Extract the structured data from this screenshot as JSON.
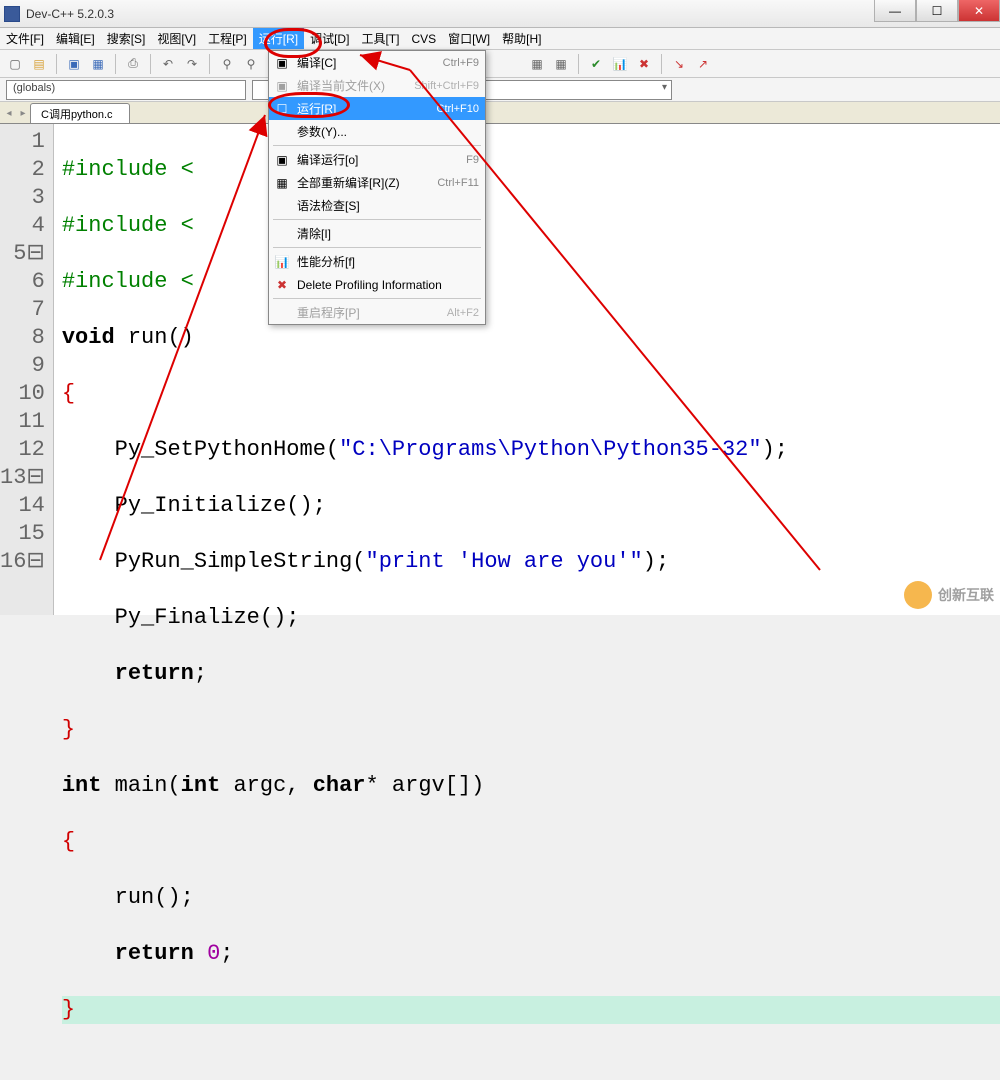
{
  "window": {
    "title": "Dev-C++ 5.2.0.3"
  },
  "menubar": {
    "items": [
      {
        "label": "文件[F]"
      },
      {
        "label": "编辑[E]"
      },
      {
        "label": "搜索[S]"
      },
      {
        "label": "视图[V]"
      },
      {
        "label": "工程[P]"
      },
      {
        "label": "运行[R]",
        "active": true
      },
      {
        "label": "调试[D]"
      },
      {
        "label": "工具[T]"
      },
      {
        "label": "CVS"
      },
      {
        "label": "窗口[W]"
      },
      {
        "label": "帮助[H]"
      }
    ]
  },
  "globals": {
    "label": "(globals)"
  },
  "tabs": {
    "file": "C调用python.c"
  },
  "dropdown": {
    "items": [
      {
        "icon": "cube",
        "label": "编译[C]",
        "shortcut": "Ctrl+F9"
      },
      {
        "icon": "cube",
        "label": "编译当前文件(X)",
        "shortcut": "Shift+Ctrl+F9",
        "disabled": true
      },
      {
        "icon": "window",
        "label": "运行[R]",
        "shortcut": "Ctrl+F10",
        "selected": true
      },
      {
        "icon": "",
        "label": "参数(Y)..."
      },
      {
        "sep": true
      },
      {
        "icon": "cube",
        "label": "编译运行[o]",
        "shortcut": "F9"
      },
      {
        "icon": "grid",
        "label": "全部重新编译[R](Z)",
        "shortcut": "Ctrl+F11"
      },
      {
        "icon": "",
        "label": "语法检查[S]"
      },
      {
        "sep": true
      },
      {
        "icon": "",
        "label": "清除[I]"
      },
      {
        "sep": true
      },
      {
        "icon": "chart",
        "label": "性能分析[f]"
      },
      {
        "icon": "x",
        "label": "Delete Profiling Information"
      },
      {
        "sep": true
      },
      {
        "icon": "",
        "label": "重启程序[P]",
        "shortcut": "Alt+F2",
        "disabled": true
      }
    ]
  },
  "code": {
    "lines": [
      {
        "n": "1",
        "pre": "#include <",
        "rest": ""
      },
      {
        "n": "2",
        "pre": "#include <",
        "rest": ""
      },
      {
        "n": "3",
        "pre": "#include <",
        "rest": ""
      },
      {
        "n": "4",
        "kw1": "void",
        "fn": "run",
        "rest": "()"
      },
      {
        "n": "5",
        "fold": true,
        "brace": "{"
      },
      {
        "n": "6",
        "indent": "    ",
        "call": "Py_SetPythonHome",
        "str": "\"C:\\Programs\\Python\\Python35-32\""
      },
      {
        "n": "7",
        "indent": "    ",
        "call": "Py_Initialize",
        "suffix": "();"
      },
      {
        "n": "8",
        "indent": "    ",
        "call": "PyRun_SimpleString",
        "str": "\"print 'How are you'\""
      },
      {
        "n": "9",
        "indent": "    ",
        "call": "Py_Finalize",
        "suffix": "();"
      },
      {
        "n": "10",
        "indent": "    ",
        "kw1": "return",
        "suffix": ";"
      },
      {
        "n": "11",
        "brace": "}"
      },
      {
        "n": "12",
        "kw1": "int",
        "fn": "main",
        "sig_kw": "int",
        "sig_mid": " argc, ",
        "sig_kw2": "char",
        "sig_rest": "* argv[])"
      },
      {
        "n": "13",
        "fold": true,
        "brace": "{"
      },
      {
        "n": "14",
        "indent": "    ",
        "call": "run",
        "suffix": "();"
      },
      {
        "n": "15",
        "indent": "    ",
        "kw1": "return",
        "num": " 0",
        "suffix": ";"
      },
      {
        "n": "16",
        "fold": true,
        "brace": "}",
        "caret": true
      }
    ]
  },
  "watermark": {
    "text": "创新互联"
  }
}
